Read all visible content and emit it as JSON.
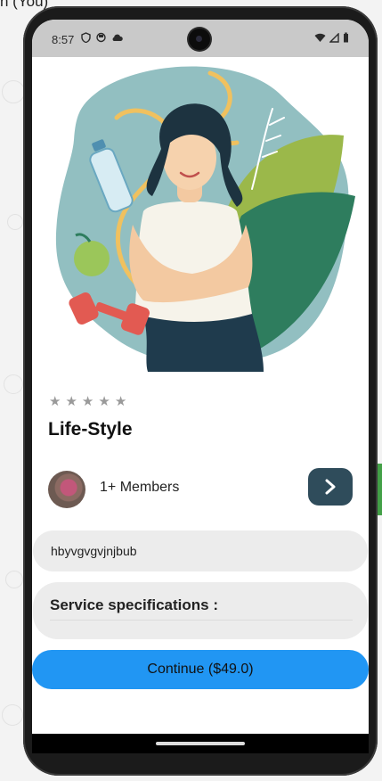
{
  "background": {
    "partial_title": "n (You)"
  },
  "status_bar": {
    "time": "8:57",
    "icons": [
      "shield-icon",
      "face-icon",
      "cloud-icon"
    ],
    "right_icons": [
      "wifi-icon",
      "signal-icon",
      "battery-icon"
    ]
  },
  "hero": {
    "illustration": "woman-fitness-illustration"
  },
  "rating": {
    "stars": 5,
    "filled": 0
  },
  "title": "Life-Style",
  "members": {
    "label": "1+ Members"
  },
  "description": {
    "text": "hbyvgvgvjnjbub"
  },
  "specifications": {
    "label": "Service specifications :"
  },
  "continue_button": {
    "label": "Continue ($49.0)"
  },
  "colors": {
    "accent": "#2196f3",
    "arrow_button": "#2f4c5b",
    "field_bg": "#ececec",
    "star": "#9a9a9a"
  }
}
